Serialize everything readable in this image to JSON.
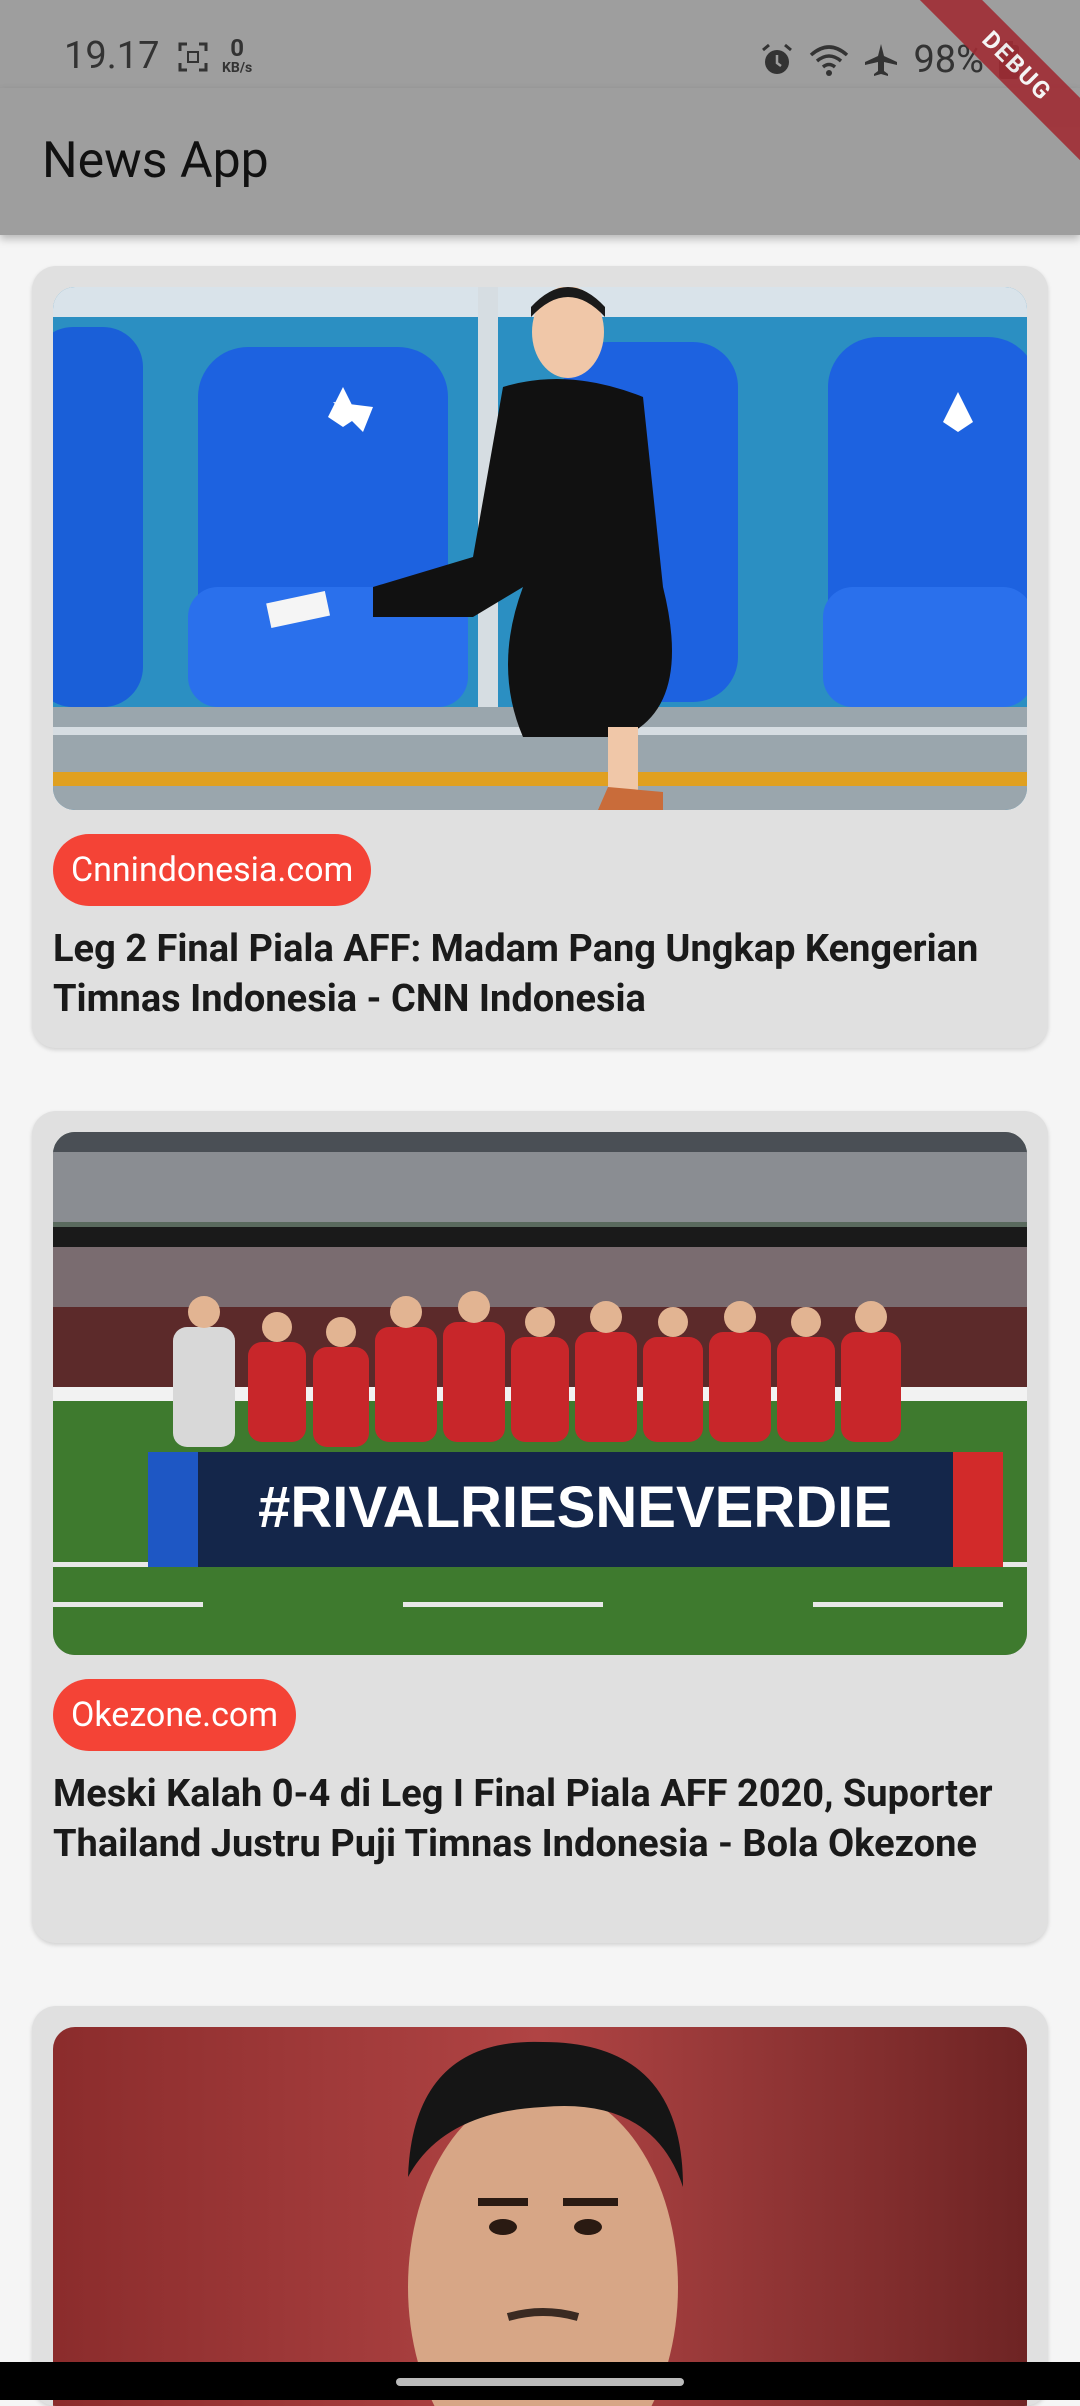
{
  "status_bar": {
    "time": "19.17",
    "net_speed_value": "0",
    "net_speed_unit": "KB/s",
    "battery": "98%",
    "icons": [
      "screenshot-icon",
      "alarm-icon",
      "wifi-icon",
      "airplane-icon",
      "battery-icon"
    ]
  },
  "debug_banner": "DEBUG",
  "app_bar": {
    "title": "News App"
  },
  "articles": [
    {
      "source": "Cnnindonesia.com",
      "title": "Leg 2 Final Piala AFF: Madam Pang Ungkap Kengerian Timnas Indonesia - CNN Indonesia",
      "image": "woman-sitting-on-dugout-photo"
    },
    {
      "source": "Okezone.com",
      "title": "Meski Kalah 0-4 di Leg I Final Piala AFF 2020, Suporter Thailand Justru Puji Timnas Indonesia - Bola Okezone",
      "image": "team-photo-stadium",
      "banner_text": "#RIVALRIESNEVERDIE"
    },
    {
      "source": "",
      "title": "",
      "image": "player-portrait-photo"
    }
  ],
  "colors": {
    "app_bar": "#9e9e9e",
    "card": "#e0e0e0",
    "chip": "#f44336",
    "background": "#f5f5f5"
  }
}
